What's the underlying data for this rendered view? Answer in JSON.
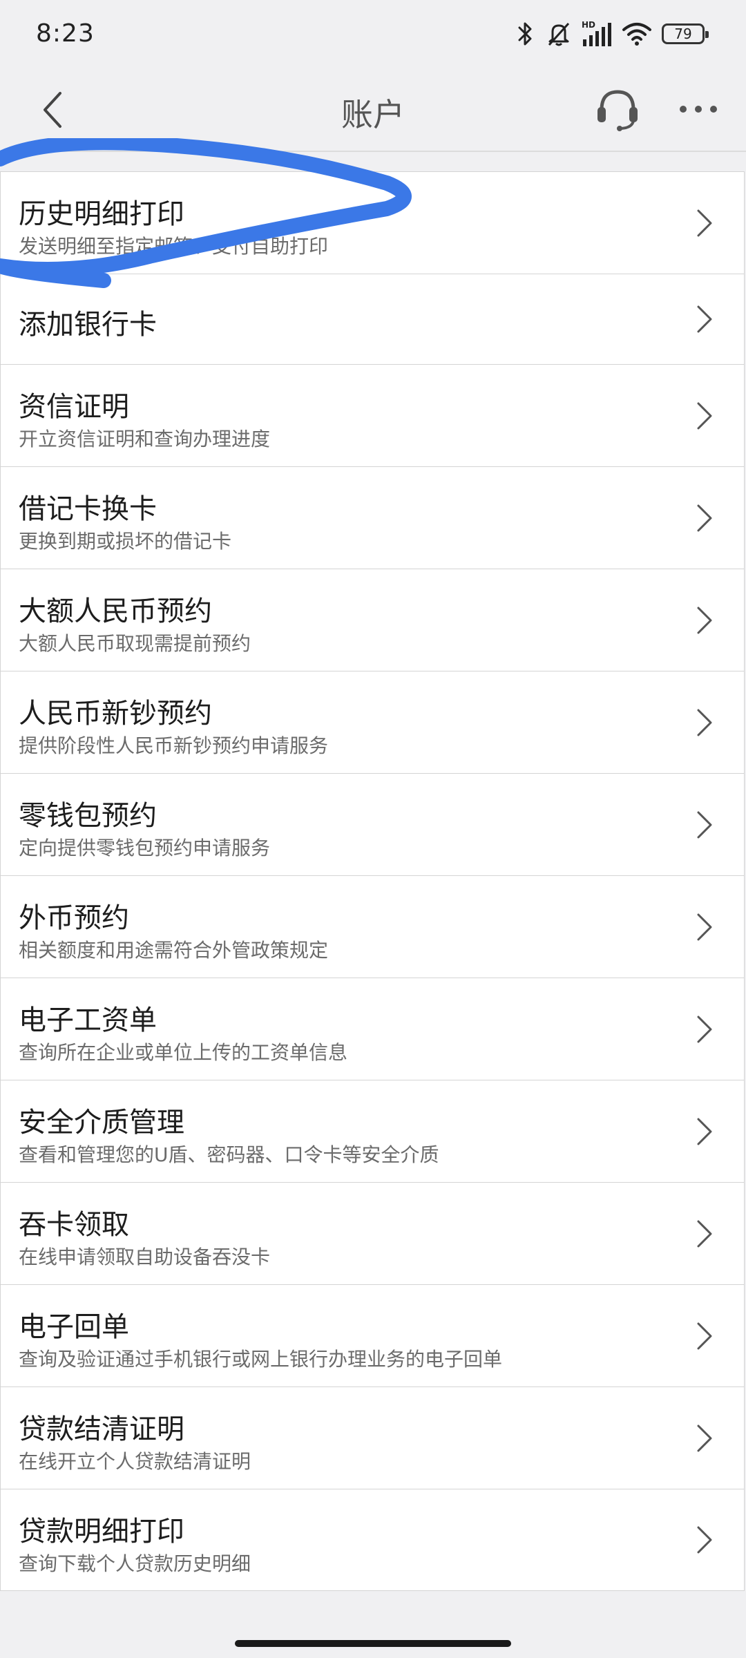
{
  "status": {
    "time": "8:23",
    "battery": "79",
    "network": "HD"
  },
  "header": {
    "title": "账户"
  },
  "icons": {
    "back": "chevron-left-icon",
    "support": "headset-icon",
    "more": "more-dots-icon",
    "row_arrow": "chevron-right-icon"
  },
  "colors": {
    "annotation": "#3b78e7",
    "background": "#f0f0f2",
    "row": "#ffffff"
  },
  "menu": {
    "items": [
      {
        "title": "历史明细打印",
        "subtitle": "发送明细至指定邮箱、支付自助打印"
      },
      {
        "title": "添加银行卡",
        "subtitle": ""
      },
      {
        "title": "资信证明",
        "subtitle": "开立资信证明和查询办理进度"
      },
      {
        "title": "借记卡换卡",
        "subtitle": "更换到期或损坏的借记卡"
      },
      {
        "title": "大额人民币预约",
        "subtitle": "大额人民币取现需提前预约"
      },
      {
        "title": "人民币新钞预约",
        "subtitle": "提供阶段性人民币新钞预约申请服务"
      },
      {
        "title": "零钱包预约",
        "subtitle": "定向提供零钱包预约申请服务"
      },
      {
        "title": "外币预约",
        "subtitle": "相关额度和用途需符合外管政策规定"
      },
      {
        "title": "电子工资单",
        "subtitle": "查询所在企业或单位上传的工资单信息"
      },
      {
        "title": "安全介质管理",
        "subtitle": "查看和管理您的U盾、密码器、口令卡等安全介质"
      },
      {
        "title": "吞卡领取",
        "subtitle": "在线申请领取自助设备吞没卡"
      },
      {
        "title": "电子回单",
        "subtitle": "查询及验证通过手机银行或网上银行办理业务的电子回单"
      },
      {
        "title": "贷款结清证明",
        "subtitle": "在线开立个人贷款结清证明"
      },
      {
        "title": "贷款明细打印",
        "subtitle": "查询下载个人贷款历史明细"
      }
    ]
  }
}
